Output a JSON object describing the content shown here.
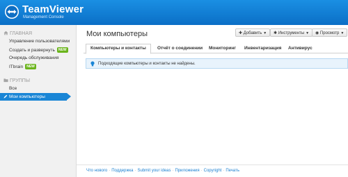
{
  "header": {
    "brand": "TeamViewer",
    "subtitle": "Management Console"
  },
  "sidebar": {
    "section_main": "ГЛАВНАЯ",
    "items": [
      {
        "label": "Управление пользователями"
      },
      {
        "label": "Создать и развернуть",
        "badge": "NEW"
      },
      {
        "label": "Очередь обслуживания"
      },
      {
        "label": "ITbrain",
        "badge": "NEW"
      }
    ],
    "section_groups": "ГРУППЫ",
    "groups": [
      {
        "label": "Все"
      },
      {
        "label": "Мои компьютеры",
        "active": true
      }
    ]
  },
  "main": {
    "title": "Мои компьютеры",
    "toolbar": {
      "add": "Добавить",
      "tools": "Инструменты",
      "view": "Просмотр"
    },
    "tabs": [
      {
        "label": "Компьютеры и контакты",
        "active": true
      },
      {
        "label": "Отчёт о соединении"
      },
      {
        "label": "Мониторинг"
      },
      {
        "label": "Инвентаризация"
      },
      {
        "label": "Антивирус"
      }
    ],
    "info_message": "Подходящие компьютеры и контакты не найдены."
  },
  "footer": {
    "links": [
      "Что нового",
      "Поддержка",
      "Submit your ideas",
      "Приложения",
      "Copyright",
      "Печать"
    ]
  },
  "colors": {
    "header": "#1a8fe3",
    "accent": "#1a86d6",
    "badge_new": "#6ab41b",
    "info_bg": "#e8f3fc"
  }
}
